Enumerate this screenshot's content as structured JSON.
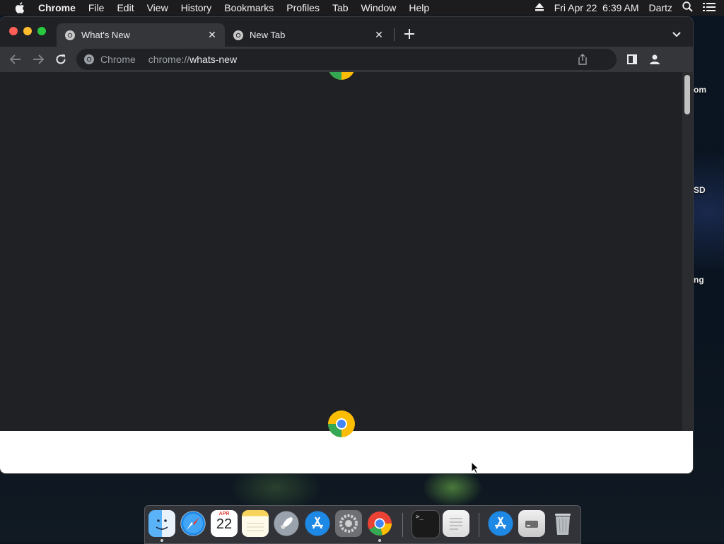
{
  "menubar": {
    "app_name": "Chrome",
    "menus": [
      "File",
      "Edit",
      "View",
      "History",
      "Bookmarks",
      "Profiles",
      "Tab",
      "Window",
      "Help"
    ],
    "datetime": "Fri Apr 22  6:39 AM",
    "user": "Dartz"
  },
  "desktop": {
    "labels": [
      "om",
      "SD",
      "ng"
    ]
  },
  "browser": {
    "tabs": [
      {
        "title": "What's New",
        "active": true
      },
      {
        "title": "New Tab",
        "active": false
      }
    ],
    "omnibox": {
      "chip_label": "Chrome",
      "url_prefix": "chrome://",
      "url_host": "whats-new"
    }
  },
  "dock": {
    "apps": [
      "finder-icon",
      "safari-icon",
      "calendar-icon",
      "notes-icon",
      "launchpad-icon",
      "app-store-icon",
      "system-preferences-icon",
      "chrome-icon",
      "terminal-icon",
      "textedit-icon",
      "app-store-downloads-icon",
      "disk-image-icon",
      "trash-icon"
    ],
    "calendar": {
      "month": "APR",
      "day": "22"
    }
  },
  "colors": {
    "chrome_red": "#ea4335",
    "chrome_yellow": "#fbbc04",
    "chrome_green": "#34a853",
    "chrome_blue": "#4285f4"
  }
}
